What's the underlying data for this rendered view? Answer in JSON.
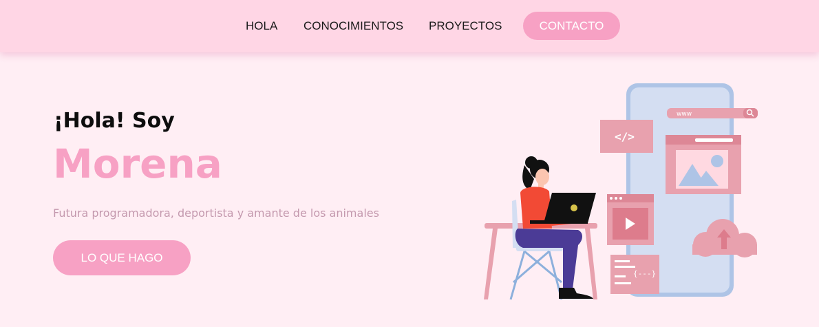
{
  "nav": {
    "links": [
      "HOLA",
      "CONOCIMIENTOS",
      "PROYECTOS"
    ],
    "contact_label": "CONTACTO"
  },
  "hero": {
    "greeting": "¡Hola! Soy",
    "name": "Morena",
    "subtitle": "Futura programadora, deportista y amante de los animales",
    "cta_label": "LO QUE HAGO"
  },
  "illustration": {
    "url_bar_text": "www",
    "code_tag": "</>",
    "code_snippet": "{---}"
  },
  "colors": {
    "background": "#ffeef4",
    "navbar": "#ffd6e5",
    "accent_pink": "#f7a1c4",
    "subtitle_text": "#c499ae"
  }
}
